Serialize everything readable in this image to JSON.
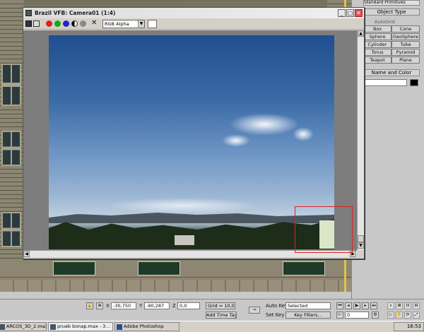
{
  "vfb": {
    "title": "Brazil VFB: Camera01 (1:4)",
    "channel": "RGB Alpha",
    "close_glyph": "✕",
    "minimize_glyph": "_",
    "maximize_glyph": "□"
  },
  "command_panel": {
    "top_dropdown": "Standard Primitives",
    "object_type_header": "Object Type",
    "autogrid_label": "AutoGrid",
    "primitives": [
      "Box",
      "Cone",
      "Sphere",
      "GeoSphere",
      "Cylinder",
      "Tube",
      "Torus",
      "Pyramid",
      "Teapot",
      "Plane"
    ],
    "name_color_header": "Name and Color"
  },
  "status": {
    "x_label": "X",
    "x_value": "-30,750",
    "y_label": "Y",
    "y_value": "-90,287",
    "z_label": "Z",
    "z_value": "0,0",
    "grid": "Grid = 10,0",
    "add_time_tag": "Add Time Tag",
    "auto_key": "Auto Key",
    "set_key": "Set Key",
    "selected": "Selected",
    "key_filters": "Key Filters...",
    "frame": "0"
  },
  "taskbar": {
    "items": [
      "ARCOS_3D_2.max ...",
      "prueb bonap.max - 3...",
      "Adobe Photoshop"
    ],
    "clock": "16:53"
  },
  "colors": {
    "close_button": "#e05050",
    "selection_rect": "#dd2222",
    "viewport_border": "#e2c24a"
  }
}
